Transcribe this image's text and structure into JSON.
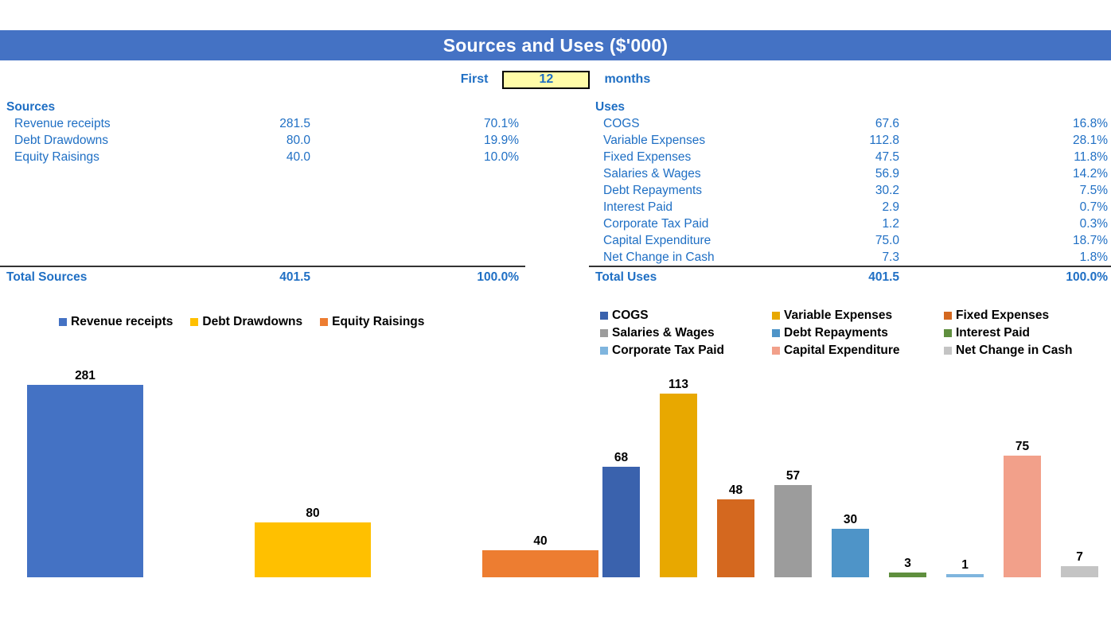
{
  "header": {
    "title": "Sources and Uses ($'000)",
    "bar_color": "#4472C4"
  },
  "period": {
    "prefix_label": "First",
    "value": "12",
    "suffix_label": "months",
    "input_bg": "#FFFCA8"
  },
  "sources": {
    "section_title": "Sources",
    "rows": [
      {
        "label": "Revenue receipts",
        "value": "281.5",
        "percent": "70.1%"
      },
      {
        "label": "Debt Drawdowns",
        "value": "80.0",
        "percent": "19.9%"
      },
      {
        "label": "Equity Raisings",
        "value": "40.0",
        "percent": "10.0%"
      }
    ],
    "total": {
      "label": "Total Sources",
      "value": "401.5",
      "percent": "100.0%"
    }
  },
  "uses": {
    "section_title": "Uses",
    "rows": [
      {
        "label": "COGS",
        "value": "67.6",
        "percent": "16.8%"
      },
      {
        "label": "Variable Expenses",
        "value": "112.8",
        "percent": "28.1%"
      },
      {
        "label": "Fixed Expenses",
        "value": "47.5",
        "percent": "11.8%"
      },
      {
        "label": "Salaries & Wages",
        "value": "56.9",
        "percent": "14.2%"
      },
      {
        "label": "Debt Repayments",
        "value": "30.2",
        "percent": "7.5%"
      },
      {
        "label": "Interest Paid",
        "value": "2.9",
        "percent": "0.7%"
      },
      {
        "label": "Corporate Tax Paid",
        "value": "1.2",
        "percent": "0.3%"
      },
      {
        "label": "Capital Expenditure",
        "value": "75.0",
        "percent": "18.7%"
      },
      {
        "label": "Net Change in Cash",
        "value": "7.3",
        "percent": "1.8%"
      }
    ],
    "total": {
      "label": "Total Uses",
      "value": "401.5",
      "percent": "100.0%"
    }
  },
  "chart_data": [
    {
      "type": "bar",
      "title": "",
      "xlabel": "",
      "ylabel": "",
      "grid": false,
      "legend_position": "top",
      "ylim": [
        0,
        300
      ],
      "categories": [
        "Revenue receipts",
        "Debt Drawdowns",
        "Equity Raisings"
      ],
      "values": [
        281,
        80,
        40
      ],
      "data_labels": [
        "281",
        "80",
        "40"
      ],
      "colors": [
        "#4472C4",
        "#FFC000",
        "#ED7D31"
      ]
    },
    {
      "type": "bar",
      "title": "",
      "xlabel": "",
      "ylabel": "",
      "grid": false,
      "legend_position": "top",
      "ylim": [
        0,
        120
      ],
      "categories": [
        "COGS",
        "Variable Expenses",
        "Fixed Expenses",
        "Salaries & Wages",
        "Debt Repayments",
        "Interest Paid",
        "Corporate Tax Paid",
        "Capital Expenditure",
        "Net Change in Cash"
      ],
      "values": [
        68,
        113,
        48,
        57,
        30,
        3,
        1,
        75,
        7
      ],
      "data_labels": [
        "68",
        "113",
        "48",
        "57",
        "30",
        "3",
        "1",
        "75",
        "7"
      ],
      "colors": [
        "#3A62AD",
        "#E8A800",
        "#D4681F",
        "#9C9C9C",
        "#4E94C8",
        "#5F8F3E",
        "#7FB5DE",
        "#F2A08A",
        "#C4C4C4"
      ]
    }
  ]
}
